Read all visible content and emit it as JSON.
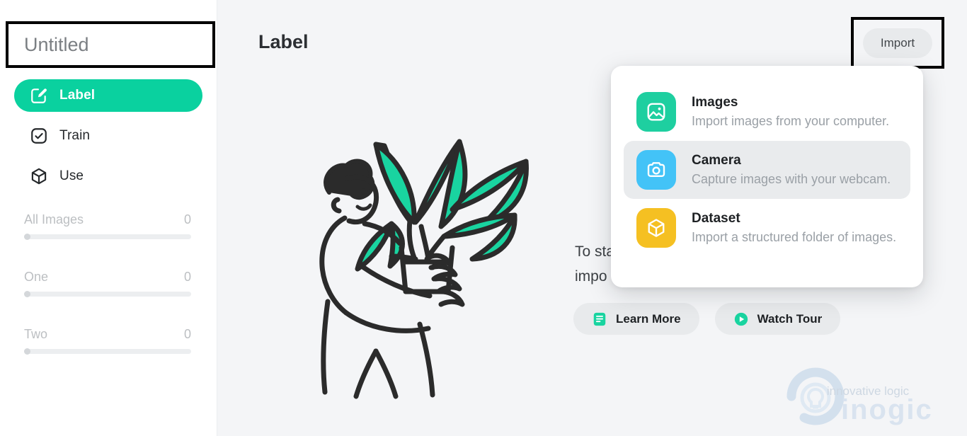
{
  "window": {
    "minimize_icon": "minimize-icon",
    "maximize_icon": "maximize-icon",
    "close_icon": "close-icon"
  },
  "sidebar": {
    "project_title": "Untitled",
    "project_title_placeholder": "Untitled",
    "nav": [
      {
        "label": "Label",
        "icon": "pencil-square-icon",
        "active": true
      },
      {
        "label": "Train",
        "icon": "check-square-icon",
        "active": false
      },
      {
        "label": "Use",
        "icon": "cube-icon",
        "active": false
      }
    ],
    "classes": [
      {
        "name": "All Images",
        "count": "0"
      },
      {
        "name": "One",
        "count": "0"
      },
      {
        "name": "Two",
        "count": "0"
      }
    ]
  },
  "main": {
    "page_title": "Label",
    "import_button": "Import",
    "empty_state_line1": "To sta",
    "empty_state_line2": "impo",
    "illustration": "person-holding-potted-plant-illustration",
    "cta": [
      {
        "label": "Learn More",
        "icon": "document-icon"
      },
      {
        "label": "Watch Tour",
        "icon": "play-circle-icon"
      }
    ]
  },
  "import_menu": {
    "items": [
      {
        "title": "Images",
        "description": "Import images from your computer.",
        "icon": "image-icon",
        "color": "#1ecfa0",
        "hovered": false
      },
      {
        "title": "Camera",
        "description": "Capture images with your webcam.",
        "icon": "camera-icon",
        "color": "#43c3f7",
        "hovered": true
      },
      {
        "title": "Dataset",
        "description": "Import a structured folder of images.",
        "icon": "cube-icon",
        "color": "#f5c022",
        "hovered": false
      }
    ]
  },
  "watermark": {
    "brand": "inogic",
    "tagline": "innovative logic"
  },
  "colors": {
    "accent_teal": "#0ad19f",
    "images_green": "#1ecfa0",
    "camera_blue": "#43c3f7",
    "dataset_yellow": "#f5c022",
    "background": "#f4f5f7",
    "sidebar": "#ffffff",
    "annotation_border": "#000000"
  }
}
